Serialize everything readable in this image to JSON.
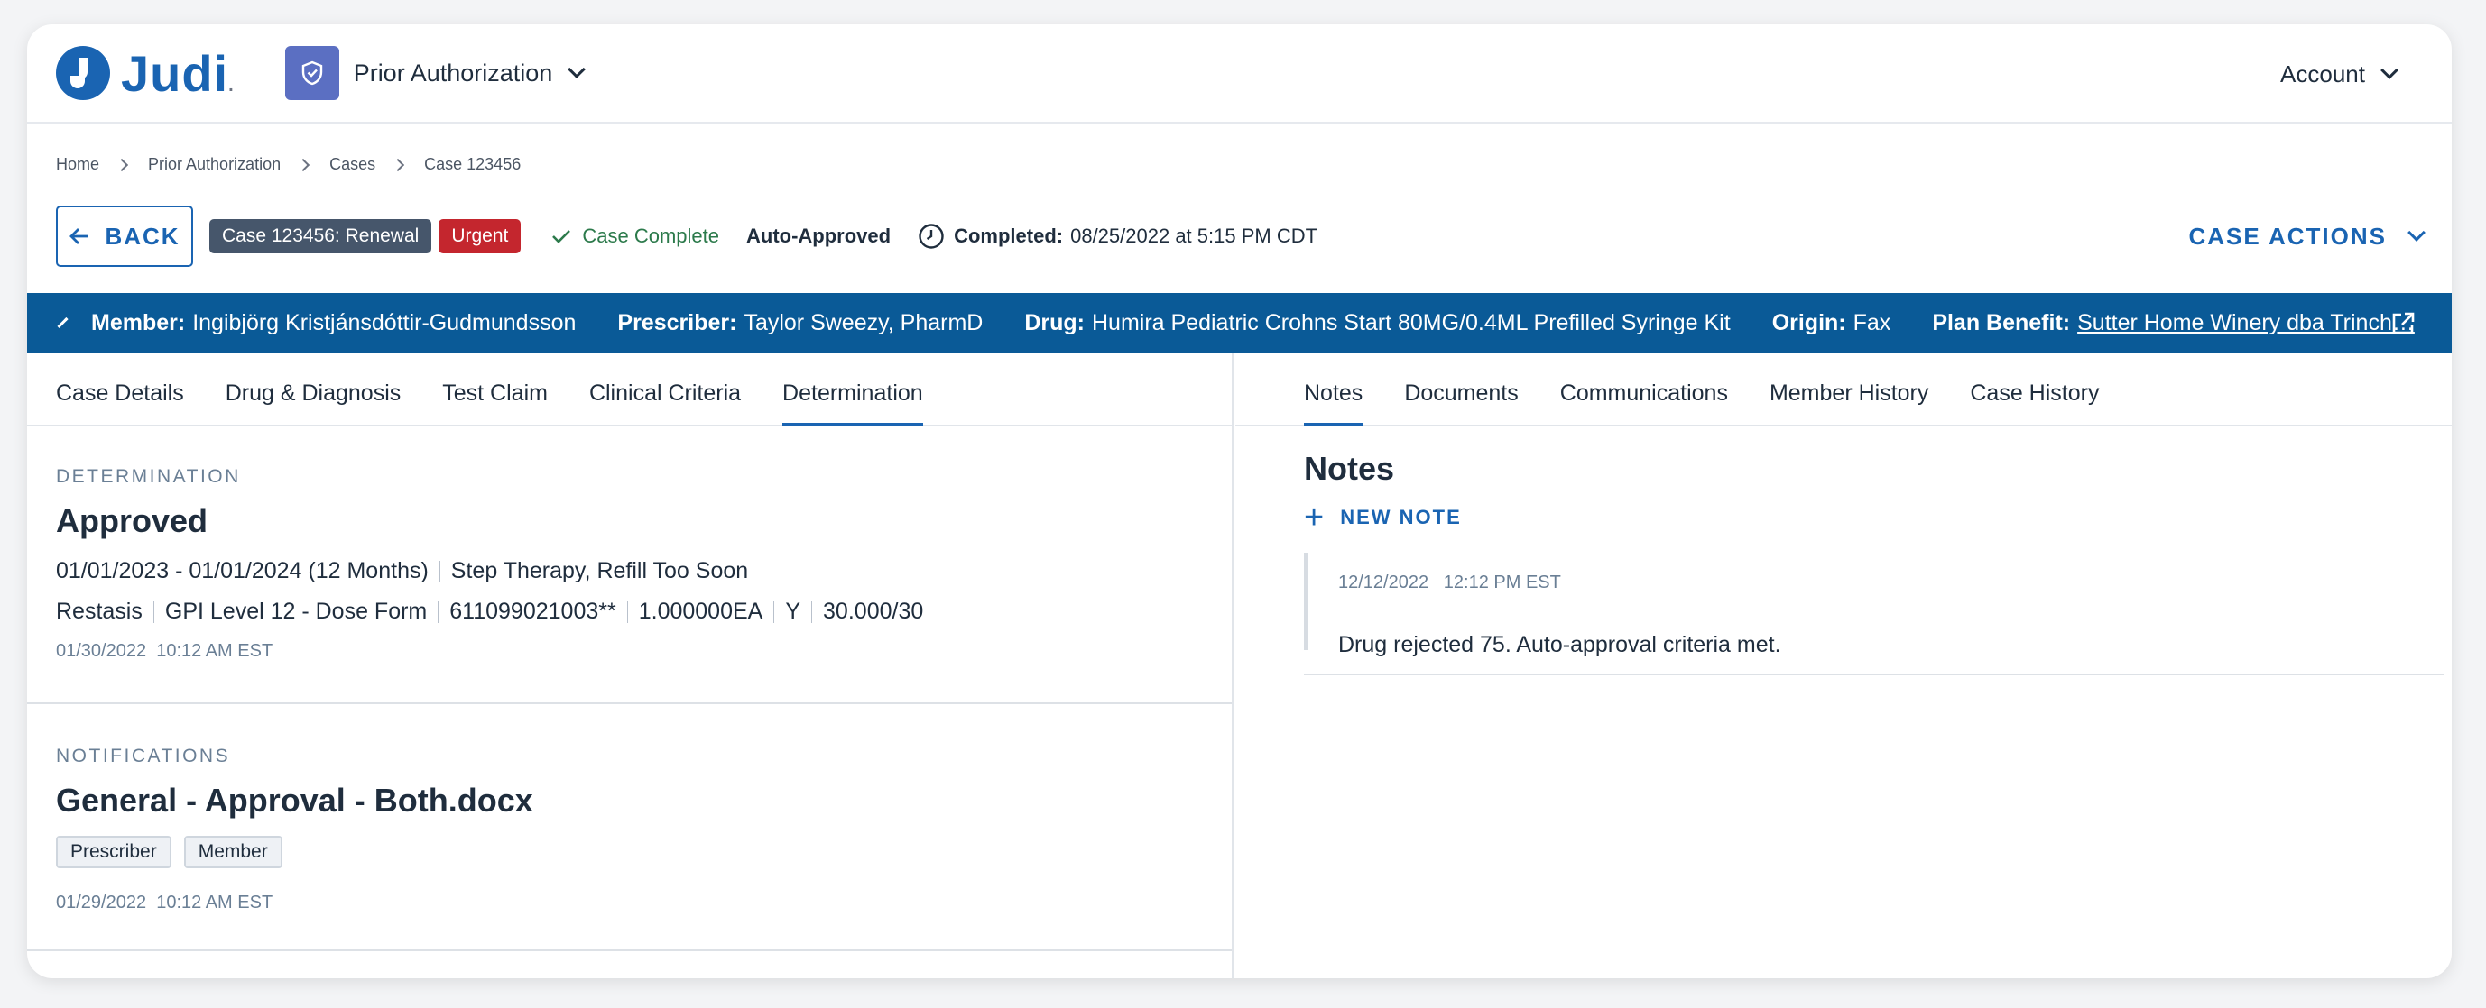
{
  "header": {
    "logo_text": "Judi",
    "app_name": "Prior Authorization",
    "account_label": "Account"
  },
  "breadcrumb": [
    "Home",
    "Prior Authorization",
    "Cases",
    "Case 123456"
  ],
  "case_bar": {
    "back_label": "BACK",
    "case_badge": "Case 123456: Renewal",
    "urgent_badge": "Urgent",
    "status": "Case Complete",
    "auto_approved": "Auto-Approved",
    "completed_label": "Completed:",
    "completed_value": "08/25/2022 at 5:15 PM CDT",
    "case_actions_label": "CASE ACTIONS"
  },
  "info_bar": {
    "member_label": "Member:",
    "member_value": "Ingibjörg Kristjánsdóttir-Gudmundsson",
    "prescriber_label": "Prescriber:",
    "prescriber_value": "Taylor Sweezy, PharmD",
    "drug_label": "Drug:",
    "drug_value": "Humira Pediatric Crohns Start 80MG/0.4ML Prefilled Syringe Kit",
    "origin_label": "Origin:",
    "origin_value": "Fax",
    "plan_label": "Plan Benefit:",
    "plan_value": "Sutter Home Winery dba Trinch…"
  },
  "left_tabs": [
    "Case Details",
    "Drug & Diagnosis",
    "Test Claim",
    "Clinical Criteria",
    "Determination"
  ],
  "right_tabs": [
    "Notes",
    "Documents",
    "Communications",
    "Member History",
    "Case History"
  ],
  "determination": {
    "eyebrow": "DETERMINATION",
    "title": "Approved",
    "period": "01/01/2023 - 01/01/2024 (12 Months)",
    "reasons": "Step Therapy, Refill Too Soon",
    "details": [
      "Restasis",
      "GPI Level 12 - Dose Form",
      "611099021003**",
      "1.000000EA",
      "Y",
      "30.000/30"
    ],
    "timestamp": "01/30/2022  10:12 AM EST"
  },
  "notifications": {
    "eyebrow": "NOTIFICATIONS",
    "title": "General - Approval - Both.docx",
    "chips": [
      "Prescriber",
      "Member"
    ],
    "timestamp": "01/29/2022  10:12 AM EST"
  },
  "notes": {
    "title": "Notes",
    "new_note_label": "NEW NOTE",
    "items": [
      {
        "date": "12/12/2022",
        "time": "12:12 PM EST",
        "text": "Drug rejected 75. Auto-approval criteria met."
      }
    ]
  },
  "colors": {
    "primary": "#1a64b2",
    "info_bar": "#0a5a97",
    "urgent": "#c4262e",
    "success": "#2c7a4b",
    "badge": "#46566b"
  }
}
